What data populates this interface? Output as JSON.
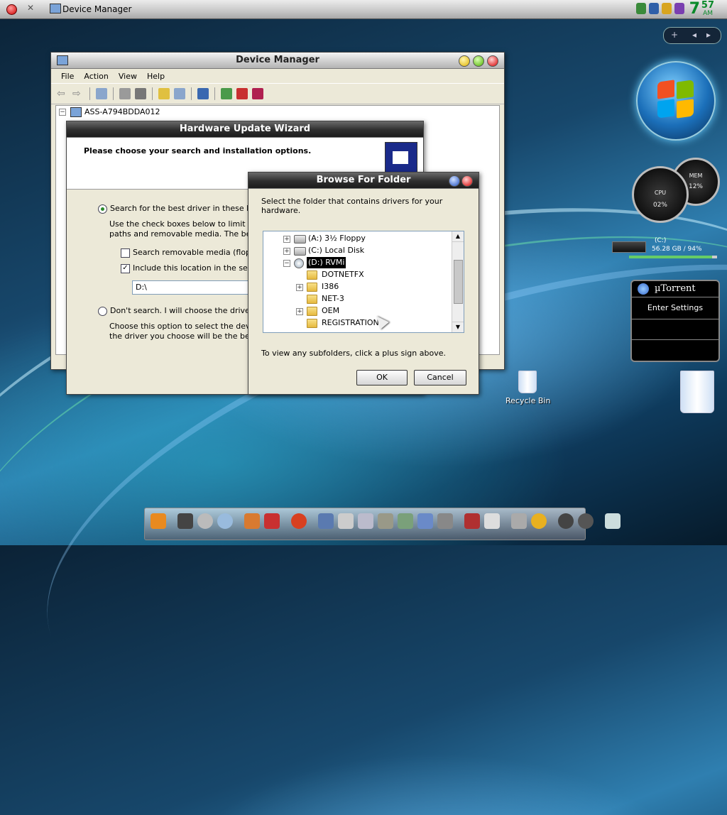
{
  "topbar": {
    "app_title": "Device Manager",
    "clock": {
      "hour": "7",
      "minute": "57",
      "ampm": "AM"
    }
  },
  "desktop_nav": {
    "add": "+",
    "prev": "◂",
    "next": "▸"
  },
  "device_manager": {
    "title": "Device Manager",
    "menu": [
      "File",
      "Action",
      "View",
      "Help"
    ],
    "computer_name": "ASS-A794BDDA012"
  },
  "wizard": {
    "title": "Hardware Update Wizard",
    "heading": "Please choose your search and installation options.",
    "option_search_label": "Search for the best driver in these location",
    "option_search_desc_1": "Use the check boxes below to limit or exp",
    "option_search_desc_2": "paths and removable media. The best driv",
    "check_removable_label": "Search removable media (floppy, C",
    "check_include_label": "Include this location in the search:",
    "location_value": "D:\\",
    "option_dont_label": "Don't search. I will choose the driver to in",
    "option_dont_desc_1": "Choose this option to select the device dr",
    "option_dont_desc_2": "the driver you choose will be the best mat"
  },
  "browse": {
    "title": "Browse For Folder",
    "instruction": "Select the folder that contains drivers for your hardware.",
    "tree": [
      {
        "label": "(A:) 3½ Floppy",
        "kind": "drive",
        "expander": "+"
      },
      {
        "label": "(C:) Local Disk",
        "kind": "drive",
        "expander": "+"
      },
      {
        "label": "(D:) RVMi",
        "kind": "cd",
        "expander": "−",
        "selected": true
      },
      {
        "label": "DOTNETFX",
        "kind": "folder",
        "expander": ""
      },
      {
        "label": "I386",
        "kind": "folder",
        "expander": "+"
      },
      {
        "label": "NET-3",
        "kind": "folder",
        "expander": ""
      },
      {
        "label": "OEM",
        "kind": "folder",
        "expander": "+"
      },
      {
        "label": "REGISTRATION",
        "kind": "folder",
        "expander": ""
      }
    ],
    "hint": "To view any subfolders, click a plus sign above.",
    "ok_label": "OK",
    "cancel_label": "Cancel"
  },
  "gadgets": {
    "gauge_cpu_label": "CPU",
    "gauge_cpu_value": "02%",
    "gauge_mem_label": "MEM",
    "gauge_mem_value": "12%",
    "drive_label": "(C:)",
    "drive_info": "56.28 GB / 94%",
    "utorrent_title": "µTorrent",
    "utorrent_action": "Enter Settings"
  },
  "desktop": {
    "recycle_bin_label": "Recycle Bin"
  }
}
